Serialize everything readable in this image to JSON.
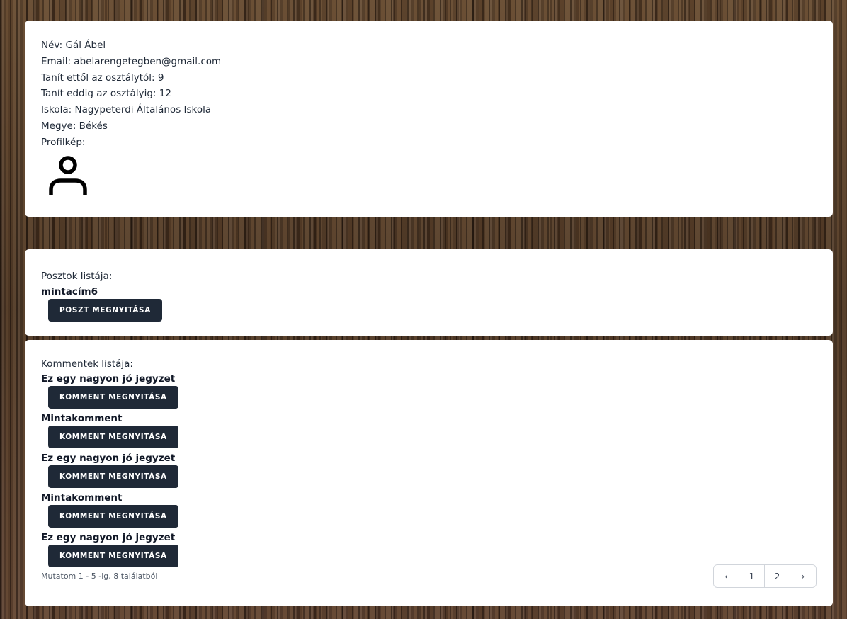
{
  "profile": {
    "lines": [
      "Név: Gál Ábel",
      "Email: abelarengetegben@gmail.com",
      "Tanít ettől az osztálytól: 9",
      "Tanít eddig az osztályig: 12",
      "Iskola: Nagypeterdi Általános Iskola",
      "Megye: Békés",
      "Profilkép:"
    ],
    "avatar_icon": "user-icon"
  },
  "posts": {
    "label": "Posztok listája:",
    "items": [
      {
        "title": "mintacím6",
        "button": "POSZT MEGNYITÁSA"
      }
    ]
  },
  "comments": {
    "label": "Kommentek listája:",
    "items": [
      {
        "title": "Ez egy nagyon jó jegyzet",
        "button": "KOMMENT MEGNYITÁSA"
      },
      {
        "title": "Mintakomment",
        "button": "KOMMENT MEGNYITÁSA"
      },
      {
        "title": "Ez egy nagyon jó jegyzet",
        "button": "KOMMENT MEGNYITÁSA"
      },
      {
        "title": "Mintakomment",
        "button": "KOMMENT MEGNYITÁSA"
      },
      {
        "title": "Ez egy nagyon jó jegyzet",
        "button": "KOMMENT MEGNYITÁSA"
      }
    ],
    "summary": "Mutatom 1 - 5 -ig, 8 találatból",
    "pagination": {
      "prev": "‹",
      "pages": [
        "1",
        "2"
      ],
      "next": "›"
    }
  }
}
